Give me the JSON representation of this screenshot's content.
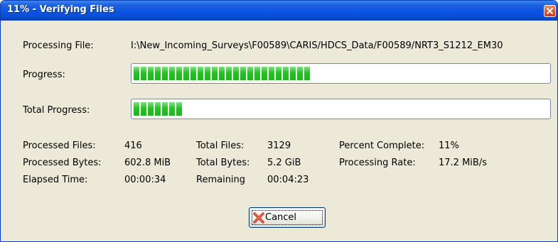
{
  "window": {
    "title": "11% - Verifying Files",
    "title_color": "#ffffff",
    "titlebar_color": "#0a54e3",
    "close_icon": "close-icon"
  },
  "processing_file": {
    "label": "Processing File:",
    "value": "I:\\New_Incoming_Surveys\\F00589\\CARIS/HDCS_Data/F00589/NRT3_S1212_EM30"
  },
  "progress": {
    "label": "Progress:",
    "fraction": 0.43,
    "fill_color": "#22c420"
  },
  "total_progress": {
    "label": "Total Progress:",
    "fraction": 0.12,
    "fill_color": "#22c420"
  },
  "stats": {
    "processed_files": {
      "label": "Processed Files:",
      "value": "416"
    },
    "processed_bytes": {
      "label": "Processed Bytes:",
      "value": "602.8 MiB"
    },
    "elapsed_time": {
      "label": "Elapsed Time:",
      "value": "00:00:34"
    },
    "total_files": {
      "label": "Total Files:",
      "value": "3129"
    },
    "total_bytes": {
      "label": "Total Bytes:",
      "value": "5.2 GiB"
    },
    "remaining": {
      "label": "Remaining",
      "value": "00:04:23"
    },
    "percent_complete": {
      "label": "Percent Complete:",
      "value": "11%"
    },
    "processing_rate": {
      "label": "Processing Rate:",
      "value": "17.2 MiB/s"
    }
  },
  "cancel_button": {
    "label": "Cancel",
    "icon": "cancel-x-icon"
  }
}
